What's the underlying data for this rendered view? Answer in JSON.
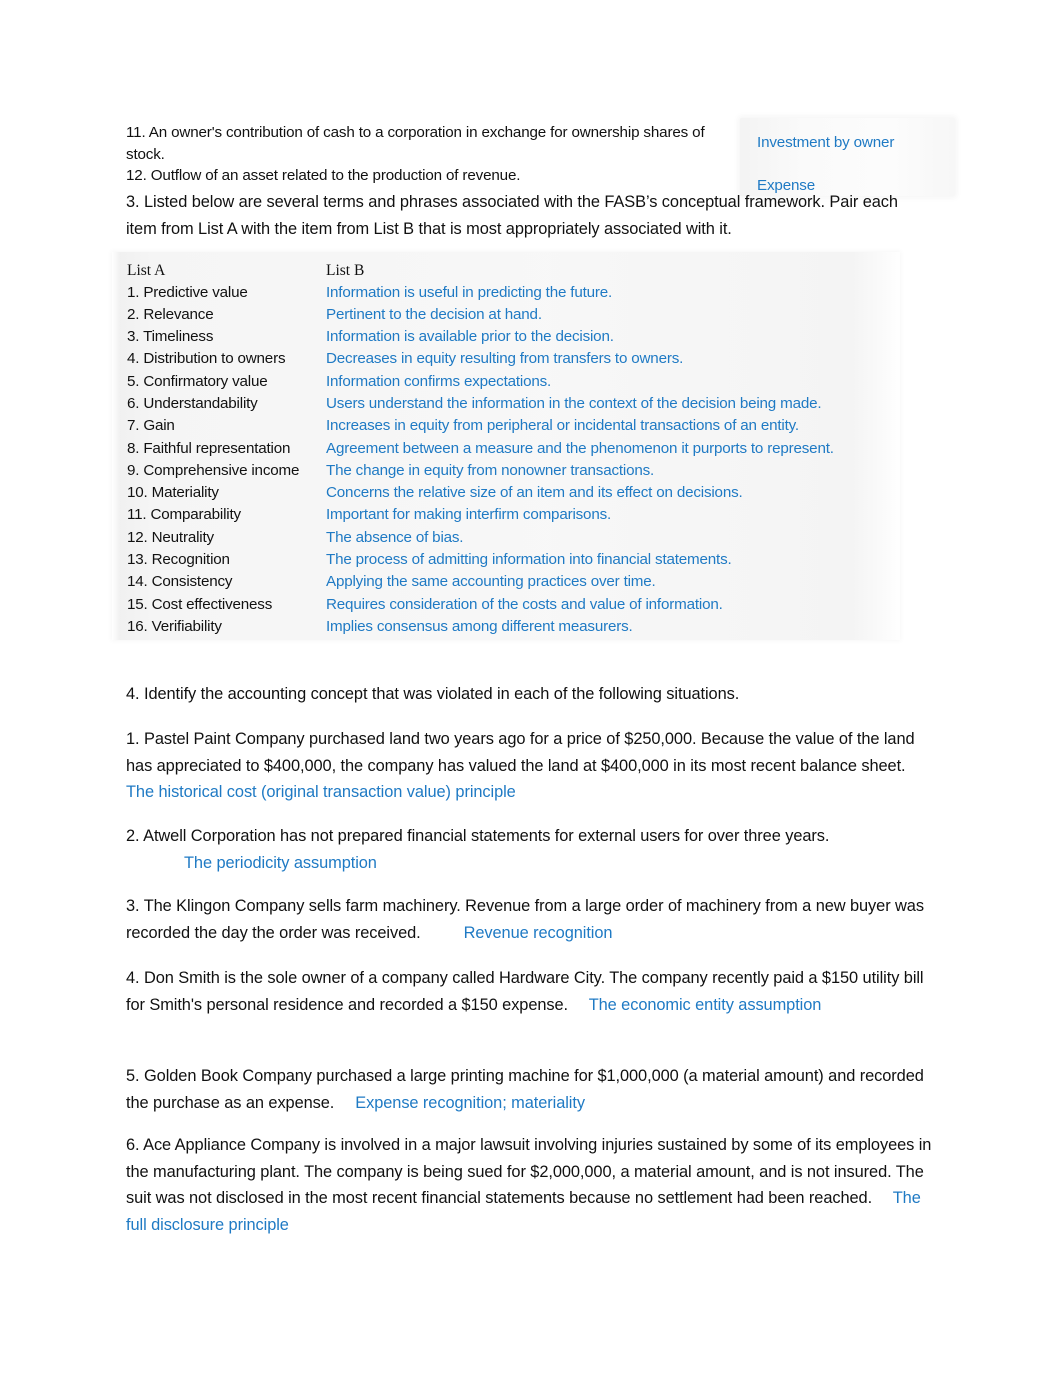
{
  "document": {
    "top_items": [
      {
        "number": "11.",
        "text": "An owner's contribution of cash to a corporation in exchange for ownership shares of stock."
      },
      {
        "number": "12.",
        "text": "Outflow of an asset related to the production of revenue."
      }
    ],
    "top_answers": [
      "Investment by owner",
      "Expense"
    ],
    "question3_intro": "3.  Listed below are several terms and phrases associated with the FASB’s conceptual framework. Pair each item from List A with the item from List B that is most appropriately associated with it.",
    "list_table": {
      "header_a": "List A",
      "header_b": "List B",
      "rows": [
        {
          "a": "1. Predictive value",
          "b": "Information is useful in predicting the future."
        },
        {
          "a": "2. Relevance",
          "b": "Pertinent to the decision at hand."
        },
        {
          "a": "3. Timeliness",
          "b": "Information is available prior to the decision."
        },
        {
          "a": "4. Distribution to owners",
          "b": "Decreases in equity resulting from transfers to owners."
        },
        {
          "a": "5. Confirmatory value",
          "b": "Information confirms expectations."
        },
        {
          "a": "6. Understandability",
          "b": "Users understand the information in the context of the decision being made."
        },
        {
          "a": "7. Gain",
          "b": "Increases in equity from peripheral or incidental transactions of an entity."
        },
        {
          "a": "8. Faithful representation",
          "b": "Agreement between a measure and the phenomenon it purports to represent."
        },
        {
          "a": "9. Comprehensive income",
          "b": "The change in equity from nonowner transactions."
        },
        {
          "a": "10. Materiality",
          "b": "Concerns the relative size of an item and its effect on decisions."
        },
        {
          "a": "11. Comparability",
          "b": "Important for making interfirm comparisons."
        },
        {
          "a": "12. Neutrality",
          "b": "The absence of bias."
        },
        {
          "a": "13. Recognition",
          "b": "The process of admitting information into financial statements."
        },
        {
          "a": "14. Consistency",
          "b": "Applying the same accounting practices over time."
        },
        {
          "a": "15. Cost effectiveness",
          "b": "Requires consideration of the costs and value of information."
        },
        {
          "a": "16. Verifiability",
          "b": "Implies consensus among different measurers."
        }
      ]
    },
    "question4_heading": "4. Identify the accounting concept that was violated in each of the following situations.",
    "situations": [
      {
        "number": "1.",
        "text": "Pastel Paint Company purchased land two years ago for a price of $250,000. Because the value of the land has appreciated to $400,000, the company has valued the land at $400,000 in its most recent balance sheet.",
        "answer": "The historical cost (original transaction value) principle"
      },
      {
        "number": "2.",
        "text": "Atwell Corporation has not prepared financial statements for external users for over three years.",
        "answer": "The periodicity assumption"
      },
      {
        "number": "3.",
        "text": "The Klingon Company sells farm machinery. Revenue from a large order of machinery from a new buyer was recorded the day the order was received.",
        "answer": "Revenue recognition"
      },
      {
        "number": "4.",
        "text": "Don Smith is the sole owner of a company called Hardware City. The company recently paid a $150 utility bill for Smith's personal residence and recorded a $150 expense.",
        "answer": "The economic entity assumption"
      },
      {
        "number": "5.",
        "text": "Golden Book Company purchased a large printing machine for $1,000,000 (a material amount) and recorded the purchase as an expense.",
        "answer": "Expense recognition; materiality"
      },
      {
        "number": "6.",
        "text": "Ace Appliance Company is involved in a major lawsuit involving injuries sustained by some of its employees in the manufacturing plant. The company is being sued for $2,000,000, a material amount, and is not insured. The suit was not disclosed in the most recent financial statements because no settlement had been reached.",
        "answer": "The full disclosure principle"
      }
    ],
    "colors": {
      "answer_blue": "#1F7AC4",
      "body_text": "#111111",
      "panel_background": "#F4F4F4",
      "page_background": "#FFFFFF"
    }
  }
}
